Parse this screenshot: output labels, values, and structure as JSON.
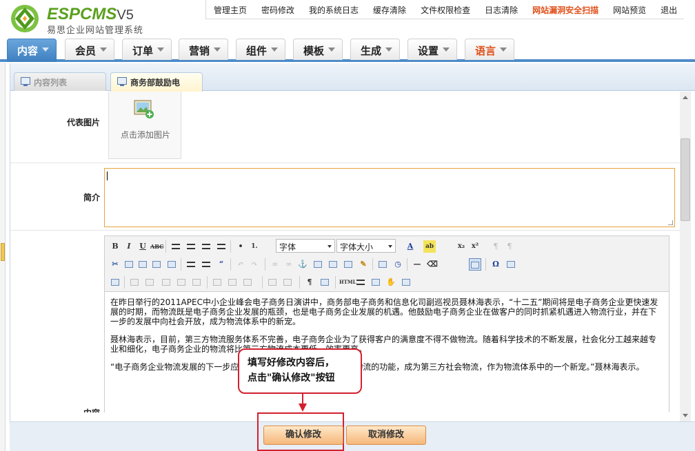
{
  "brand": {
    "name": "ESPCMS",
    "version": "V5",
    "subtitle": "易思企业网站管理系统"
  },
  "toplinks": [
    {
      "label": "管理主页"
    },
    {
      "label": "密码修改"
    },
    {
      "label": "我的系统日志"
    },
    {
      "label": "缓存清除"
    },
    {
      "label": "文件权限检查"
    },
    {
      "label": "日志清除"
    },
    {
      "label": "网站漏洞安全扫描"
    },
    {
      "label": "网站预览"
    },
    {
      "label": "退出"
    }
  ],
  "nav": [
    {
      "label": "内容"
    },
    {
      "label": "会员"
    },
    {
      "label": "订单"
    },
    {
      "label": "营销"
    },
    {
      "label": "组件"
    },
    {
      "label": "模板"
    },
    {
      "label": "生成"
    },
    {
      "label": "设置"
    },
    {
      "label": "语言"
    }
  ],
  "subtabs": {
    "list": "内容列表",
    "current": "商务部鼓励电"
  },
  "form": {
    "image_label": "代表图片",
    "image_caption": "点击添加图片",
    "summary_label": "简介",
    "summary_value": "",
    "content_label": "内容"
  },
  "editor": {
    "font_select": "字体",
    "size_select": "字体大小",
    "paragraphs": [
      "在昨日举行的2011APEC中小企业峰会电子商务日演讲中，商务部电子商务和信息化司副巡视员聂林海表示，“十二五”期间将是电子商务企业更快速发展的时期，而物流既是电子商务企业发展的瓶颈，也是电子商务企业发展的机遇。他鼓励电子商务企业在做客户的同时抓紧机遇进入物流行业，并在下一步的发展中向社会开放，成为物流体系中的新宠。",
      "聂林海表示，目前，第三方物流服务体系不完善，电子商务企业为了获得客户的满意度不得不做物流。随着科学技术的不断发展，社会化分工越来越专业和细化，电子商务企业的物流将比第三方物流成本更低，效率更高。",
      "“电子商务企业物流发展的下一步应该是向社会开放，来承担社会化物流的功能，成为第三方社会物流，作为物流体系中的一个新宠。”聂林海表示。"
    ]
  },
  "callout": {
    "line1": "填写好修改内容后，",
    "line2": "点击\"确认修改\"按钮"
  },
  "buttons": {
    "confirm": "确认修改",
    "cancel": "取消修改"
  },
  "colors": {
    "accent_green": "#5aa01e",
    "nav_blue": "#3e7fc0",
    "alert_red": "#d2202f",
    "highlight_orange": "#e0501a"
  }
}
